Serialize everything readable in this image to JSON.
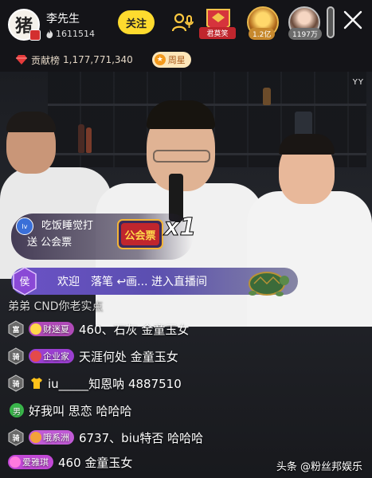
{
  "header": {
    "avatar_glyph": "猪",
    "host_name": "李先生",
    "fans": "1611514",
    "follow_label": "关注",
    "rank_badge": "君莫笑",
    "viewers": [
      {
        "count": "1.2亿"
      },
      {
        "count": "1197万"
      }
    ],
    "close_icon": "close-icon"
  },
  "contrib": {
    "label": "贡献榜",
    "value": "1,177,771,340",
    "week_star": "周星"
  },
  "video": {
    "watermark_corner": "YY",
    "gift": {
      "user_badge": "lv",
      "user": "吃饭睡觉打",
      "action": "送 公会票",
      "gift_label": "公会票",
      "multiplier": "x1"
    },
    "welcome": {
      "rank_glyph": "侯",
      "text": "欢迎　落笔 ↩画... 进入直播间"
    }
  },
  "chat": [
    {
      "type": "sys",
      "text": "弟弟 CND你老实点"
    },
    {
      "level": "富",
      "level_color": "#6b6b6b",
      "badge": "财迷夏",
      "badge_color": "#b04ab8",
      "text": "460、石灰 金童玉女"
    },
    {
      "level": "骑",
      "level_color": "#6b6b6b",
      "badge": "企业家",
      "badge_color": "#9b3fd1",
      "text": "天涯何处 金童玉女"
    },
    {
      "level": "骑",
      "level_color": "#6b6b6b",
      "icon": "shirt-icon",
      "text": "iu_____知恩呐 4887510"
    },
    {
      "gender": "男",
      "text": "好我叫 思恋 哈哈哈"
    },
    {
      "level": "骑",
      "level_color": "#6b6b6b",
      "badge": "哦系洲",
      "badge_color": "#c15bd6",
      "text": "6737、biu特否 哈哈哈"
    },
    {
      "badge": "爱雅琪",
      "badge_color": "#c248d6",
      "text": "460 金童玉女"
    }
  ],
  "watermark": "头条 @粉丝邦娱乐",
  "colors": {
    "accent_yellow": "#ffdb2e",
    "welcome_purple": "#6b52c6"
  }
}
